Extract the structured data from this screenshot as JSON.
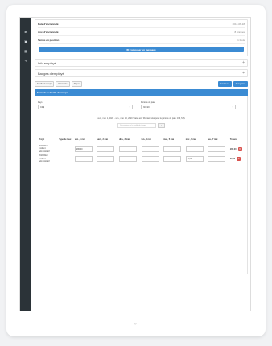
{
  "info": {
    "rows": [
      {
        "label": "Date d'ancienneté",
        "value": "2012-06-18"
      },
      {
        "label": "Anc. d'ancienneté",
        "value": "8 Années"
      },
      {
        "label": "Temps en position",
        "value": "1 Mois"
      }
    ],
    "compose_label": "✉ Composer un message"
  },
  "sections": {
    "info_employe": "Info employé",
    "badges": "Badges d'employé"
  },
  "toolbar": {
    "feuille": "Feuille de temps",
    "sommaire": "Sommaire",
    "recus": "Reçus",
    "continuer": "Continuer",
    "enregistrer": "Enregistrer"
  },
  "timesheet": {
    "header": "Frais de la feuille de temps",
    "year_label": "Pays",
    "year_value": "CR$",
    "period_label": "Période de paie",
    "period_value": "301/20",
    "status_text": "ven., mai. 1, 2020 - ven., mai. 15, 2020 Statut actif Montant total pour la période de paie: 196,72 $",
    "desc_placeholder": "Description de la feuille de temps",
    "columns": [
      "Projet",
      "Type de taux",
      "ven., 1 mai",
      "sam., 2 mai",
      "dim., 3 mai",
      "lun., 4 mai",
      "mar., 5 mai",
      "mer., 6 mai",
      "jeu., 7 mai",
      "Totaux"
    ],
    "rows": [
      {
        "project": "2019 R&D incident administratif",
        "values": [
          "",
          "",
          "",
          "",
          "",
          "",
          ""
        ],
        "first": "280,00",
        "total": "280,00"
      },
      {
        "project": "2019 R&D incident administratif",
        "values": [
          "",
          "",
          "",
          "",
          "",
          "",
          ""
        ],
        "sixth": "80,00",
        "total": "30,00"
      }
    ]
  },
  "icons": {
    "sidebar": [
      "share-icon",
      "lock-icon",
      "calendar-icon",
      "wrench-icon"
    ]
  }
}
